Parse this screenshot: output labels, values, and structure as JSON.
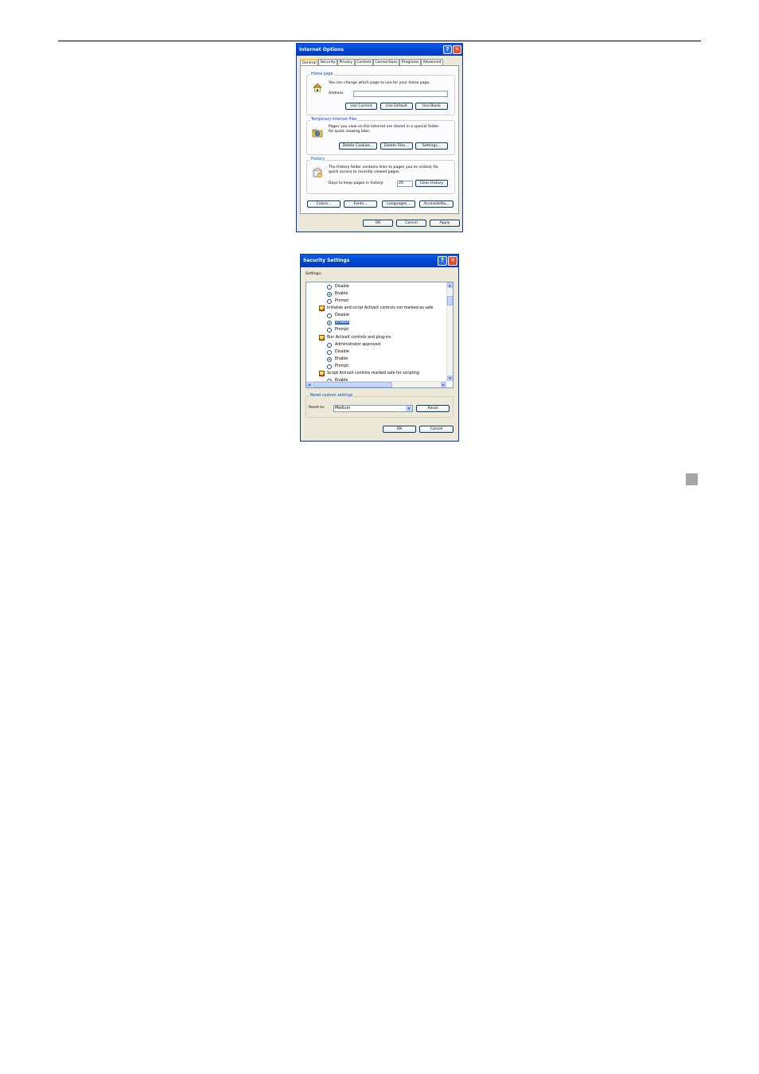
{
  "internet_options": {
    "title": "Internet Options",
    "help_glyph": "?",
    "close_glyph": "✕",
    "tabs": [
      "General",
      "Security",
      "Privacy",
      "Content",
      "Connections",
      "Programs",
      "Advanced"
    ],
    "home_page": {
      "title": "Home page",
      "description": "You can change which page to use for your home page.",
      "address_label": "Address:",
      "address_value": "",
      "use_current": "Use Current",
      "use_default": "Use Default",
      "use_blank": "Use Blank"
    },
    "temp_files": {
      "title": "Temporary Internet files",
      "description_line1": "Pages you view on the Internet are stored in a special folder",
      "description_line2": "for quick viewing later.",
      "delete_cookies": "Delete Cookies...",
      "delete_files": "Delete Files...",
      "settings": "Settings..."
    },
    "history": {
      "title": "History",
      "description_line1": "The History folder contains links to pages you've visited, for",
      "description_line2": "quick access to recently viewed pages.",
      "days_label": "Days to keep pages in history:",
      "days_value": "20",
      "clear_history": "Clear History"
    },
    "bottom_buttons": {
      "colors": "Colors...",
      "fonts": "Fonts...",
      "languages": "Languages...",
      "accessibility": "Accessibility..."
    },
    "ok": "OK",
    "cancel": "Cancel",
    "apply": "Apply"
  },
  "security_settings": {
    "title": "Security Settings",
    "help_glyph": "?",
    "close_glyph": "✕",
    "settings_label": "Settings:",
    "items": [
      {
        "kind": "radio",
        "label": "Disable",
        "checked": false
      },
      {
        "kind": "radio",
        "label": "Enable",
        "checked": true
      },
      {
        "kind": "radio",
        "label": "Prompt",
        "checked": false
      },
      {
        "kind": "category",
        "label": "Initialize and script ActiveX controls not marked as safe"
      },
      {
        "kind": "radio",
        "label": "Disable",
        "checked": false
      },
      {
        "kind": "radio",
        "label": "Enable",
        "checked": true,
        "selected": true
      },
      {
        "kind": "radio",
        "label": "Prompt",
        "checked": false
      },
      {
        "kind": "category",
        "label": "Run ActiveX controls and plug-ins"
      },
      {
        "kind": "radio",
        "label": "Administrator approved",
        "checked": false
      },
      {
        "kind": "radio",
        "label": "Disable",
        "checked": false
      },
      {
        "kind": "radio",
        "label": "Enable",
        "checked": true
      },
      {
        "kind": "radio",
        "label": "Prompt",
        "checked": false
      },
      {
        "kind": "category",
        "label": "Script ActiveX controls marked safe for scripting"
      },
      {
        "kind": "radio",
        "label": "Enable",
        "checked": false
      }
    ],
    "reset_group_title": "Reset custom settings",
    "reset_to_label": "Reset to:",
    "reset_to_value": "Medium",
    "reset_button": "Reset",
    "ok": "OK",
    "cancel": "Cancel",
    "scroll_up_glyph": "▲",
    "scroll_down_glyph": "▼",
    "scroll_left_glyph": "◀",
    "scroll_right_glyph": "▶",
    "dropdown_glyph": "▼"
  }
}
